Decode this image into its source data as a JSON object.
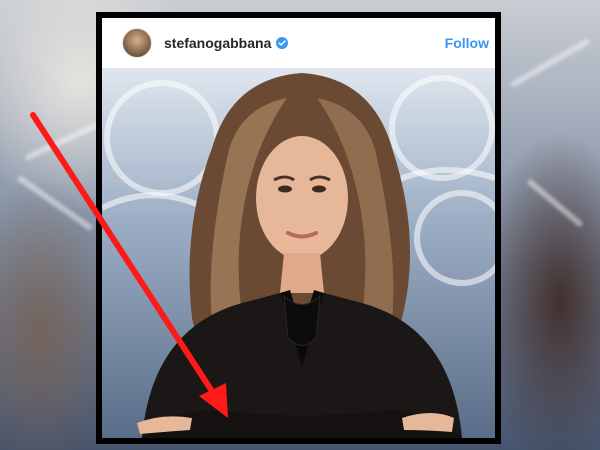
{
  "post": {
    "username": "stefanogabbana",
    "follow_label": "Follow"
  },
  "icons": {
    "verified": "verified-badge-icon",
    "avatar": "profile-avatar",
    "annotation": "red-arrow-icon"
  },
  "colors": {
    "link_blue": "#3897f0",
    "verified_blue": "#3897f0",
    "arrow_red": "#ff1a1a",
    "frame": "#000000"
  }
}
